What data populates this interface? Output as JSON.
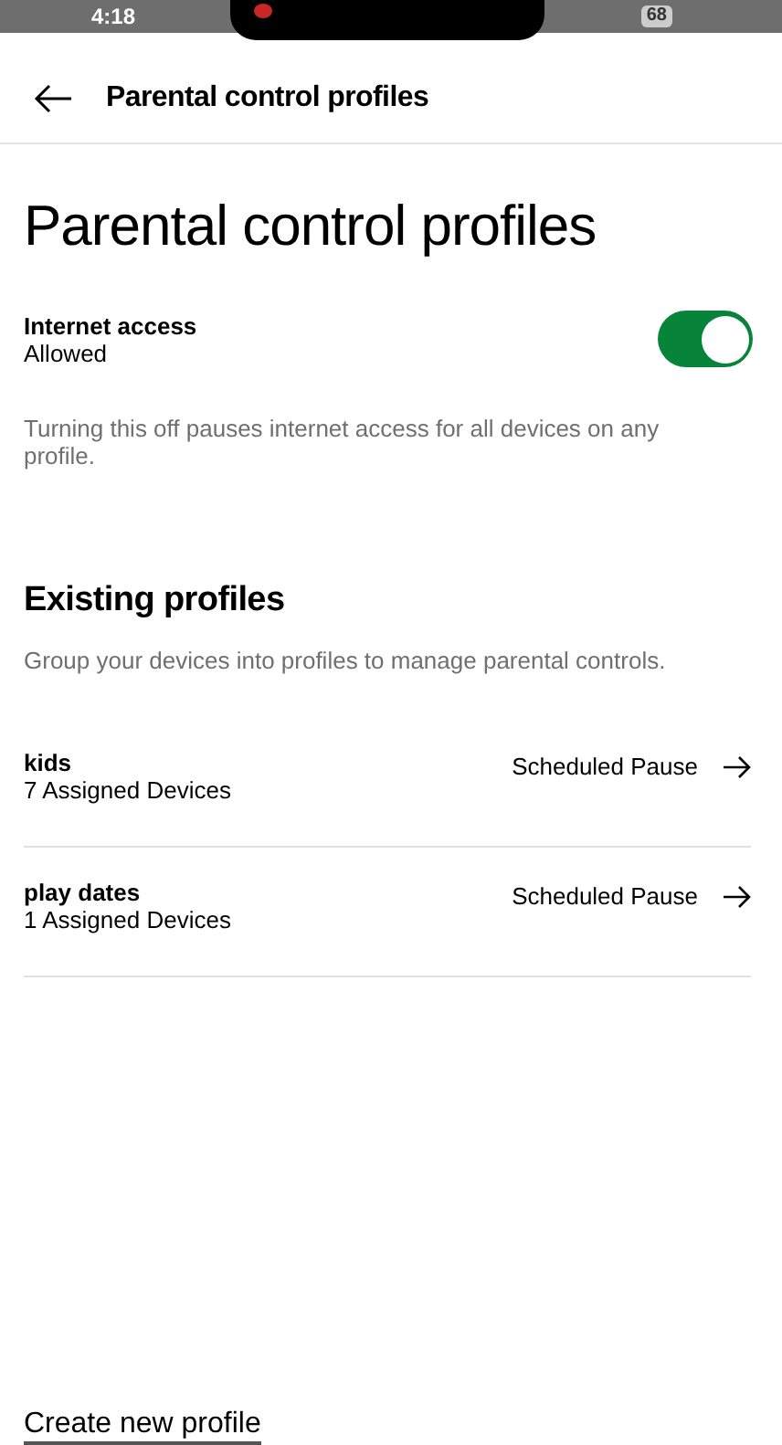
{
  "status_bar": {
    "time": "4:18",
    "battery": "68"
  },
  "header": {
    "title": "Parental control profiles"
  },
  "page_title": "Parental control profiles",
  "internet_access": {
    "label": "Internet access",
    "value": "Allowed",
    "on": true,
    "note": "Turning this off pauses internet access for all devices on any profile."
  },
  "existing_profiles": {
    "heading": "Existing profiles",
    "description": "Group your devices into profiles to manage parental controls.",
    "profiles": [
      {
        "name": "kids",
        "devices": "7 Assigned Devices",
        "status": "Scheduled Pause"
      },
      {
        "name": "play dates",
        "devices": "1 Assigned Devices",
        "status": "Scheduled Pause"
      }
    ]
  },
  "create_link": "Create new profile"
}
